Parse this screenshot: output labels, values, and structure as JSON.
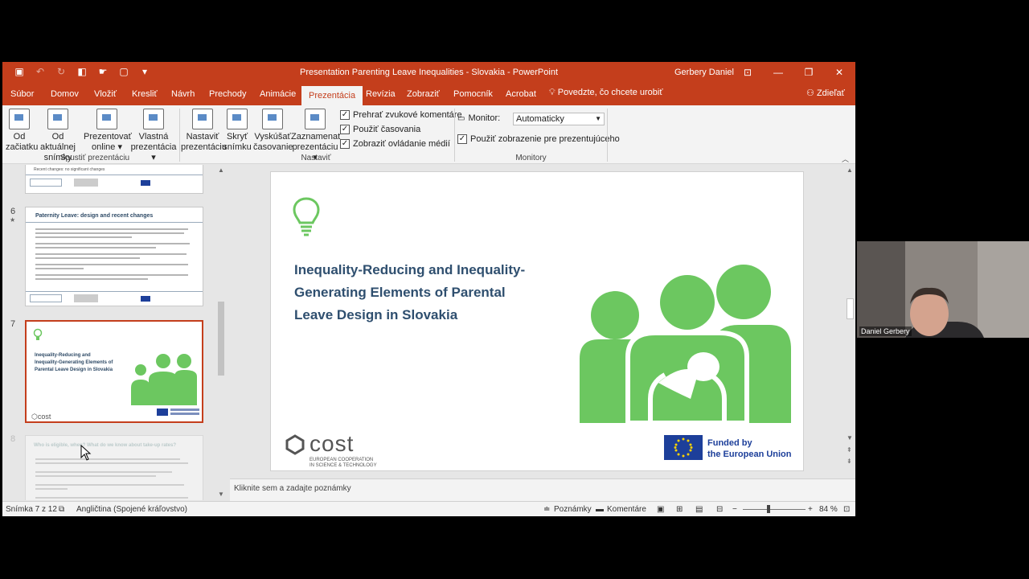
{
  "window": {
    "title": "Presentation Parenting Leave  Inequalities - Slovakia  -  PowerPoint",
    "user": "Gerbery Daniel"
  },
  "tabs": [
    "Súbor",
    "Domov",
    "Vložiť",
    "Kresliť",
    "Návrh",
    "Prechody",
    "Animácie",
    "Prezentácia",
    "Revízia",
    "Zobraziť",
    "Pomocník",
    "Acrobat"
  ],
  "active_tab": "Prezentácia",
  "tell_me": "Povedzte, čo chcete urobiť",
  "share": "Zdieľať",
  "ribbon": {
    "from_start": [
      "Od",
      "začiatku"
    ],
    "from_current": [
      "Od aktuálnej",
      "snímky"
    ],
    "present_online": [
      "Prezentovať",
      "online ▾"
    ],
    "custom_show": [
      "Vlastná",
      "prezentácia ▾"
    ],
    "group_start": "Spustiť prezentáciu",
    "setup_show": [
      "Nastaviť",
      "prezentáciu"
    ],
    "hide_slide": [
      "Skryť",
      "snímku"
    ],
    "rehearse": [
      "Vyskúšať",
      "časovanie"
    ],
    "record": [
      "Zaznamenať",
      "prezentáciu ▾"
    ],
    "check_narrations": "Prehrať zvukové komentáre",
    "check_timings": "Použiť časovania",
    "check_controls": "Zobraziť ovládanie médií",
    "group_setup": "Nastaviť",
    "monitor_label": "Monitor:",
    "monitor_value": "Automaticky",
    "presenter_view": "Použiť zobrazenie pre prezentujúceho",
    "group_monitors": "Monitory"
  },
  "thumbnails": {
    "slide5_text": "Recent changes: no significant changes",
    "slide6_number": "6",
    "slide6_title": "Paternity Leave: design and recent changes",
    "slide7_number": "7",
    "slide7_title": "Inequality-Reducing and Inequality-Generating Elements of Parental Leave Design in Slovakia",
    "slide8_number": "8",
    "slide8_title": "Who is eligible, when? What do we know about take-up rates?"
  },
  "slide": {
    "title": "Inequality-Reducing and Inequality-Generating Elements of Parental Leave Design in Slovakia",
    "cost_word": "cost",
    "cost_sub1": "EUROPEAN COOPERATION",
    "cost_sub2": "IN SCIENCE & TECHNOLOGY",
    "eu_line1": "Funded by",
    "eu_line2": "the European Union"
  },
  "notes_placeholder": "Kliknite sem a zadajte poznámky",
  "status": {
    "slide_counter": "Snímka 7 z 12",
    "language": "Angličtina (Spojené kráľovstvo)",
    "notes": "Poznámky",
    "comments": "Komentáre",
    "zoom": "84 %"
  },
  "webcam": {
    "name": "Daniel Gerbery"
  },
  "colors": {
    "accent": "#c43e1c",
    "slide_title": "#2f4f6f",
    "icon_green": "#6cc760"
  }
}
